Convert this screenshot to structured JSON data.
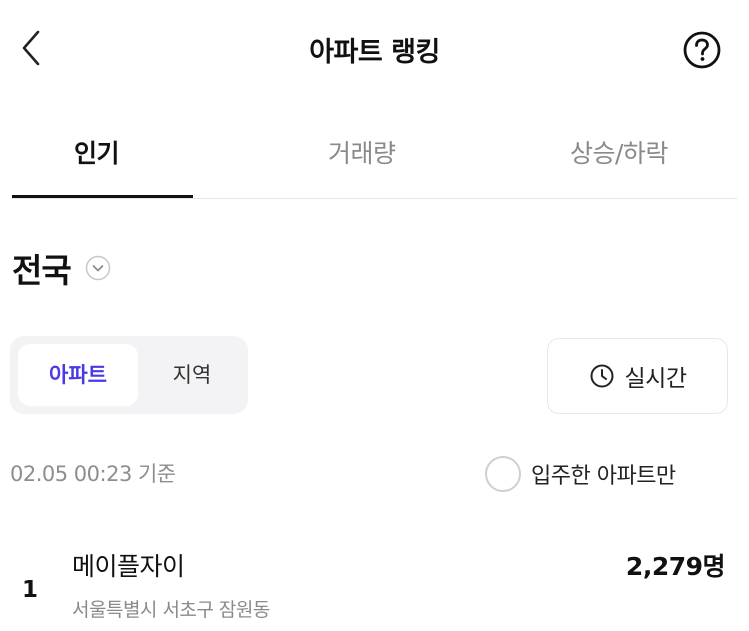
{
  "header": {
    "title": "아파트 랭킹",
    "back_icon": "chevron-left-icon",
    "help_icon": "help-circle-icon"
  },
  "tabs": [
    {
      "label": "인기",
      "active": true
    },
    {
      "label": "거래량",
      "active": false
    },
    {
      "label": "상승/하락",
      "active": false
    }
  ],
  "region": {
    "selected": "전국",
    "chevron_icon": "chevron-down-circle-icon"
  },
  "segment": {
    "options": [
      {
        "label": "아파트",
        "active": true
      },
      {
        "label": "지역",
        "active": false
      }
    ],
    "active_color": "#4a3ae6"
  },
  "realtime": {
    "label": "실시간",
    "icon": "clock-icon"
  },
  "basis": {
    "time_text": "02.05 00:23 기준"
  },
  "filter": {
    "movein_label": "입주한 아파트만",
    "checked": false
  },
  "ranking": [
    {
      "rank": "1",
      "name": "메이플자이",
      "address": "서울특별시 서초구 잠원동",
      "count": "2,279명"
    }
  ]
}
